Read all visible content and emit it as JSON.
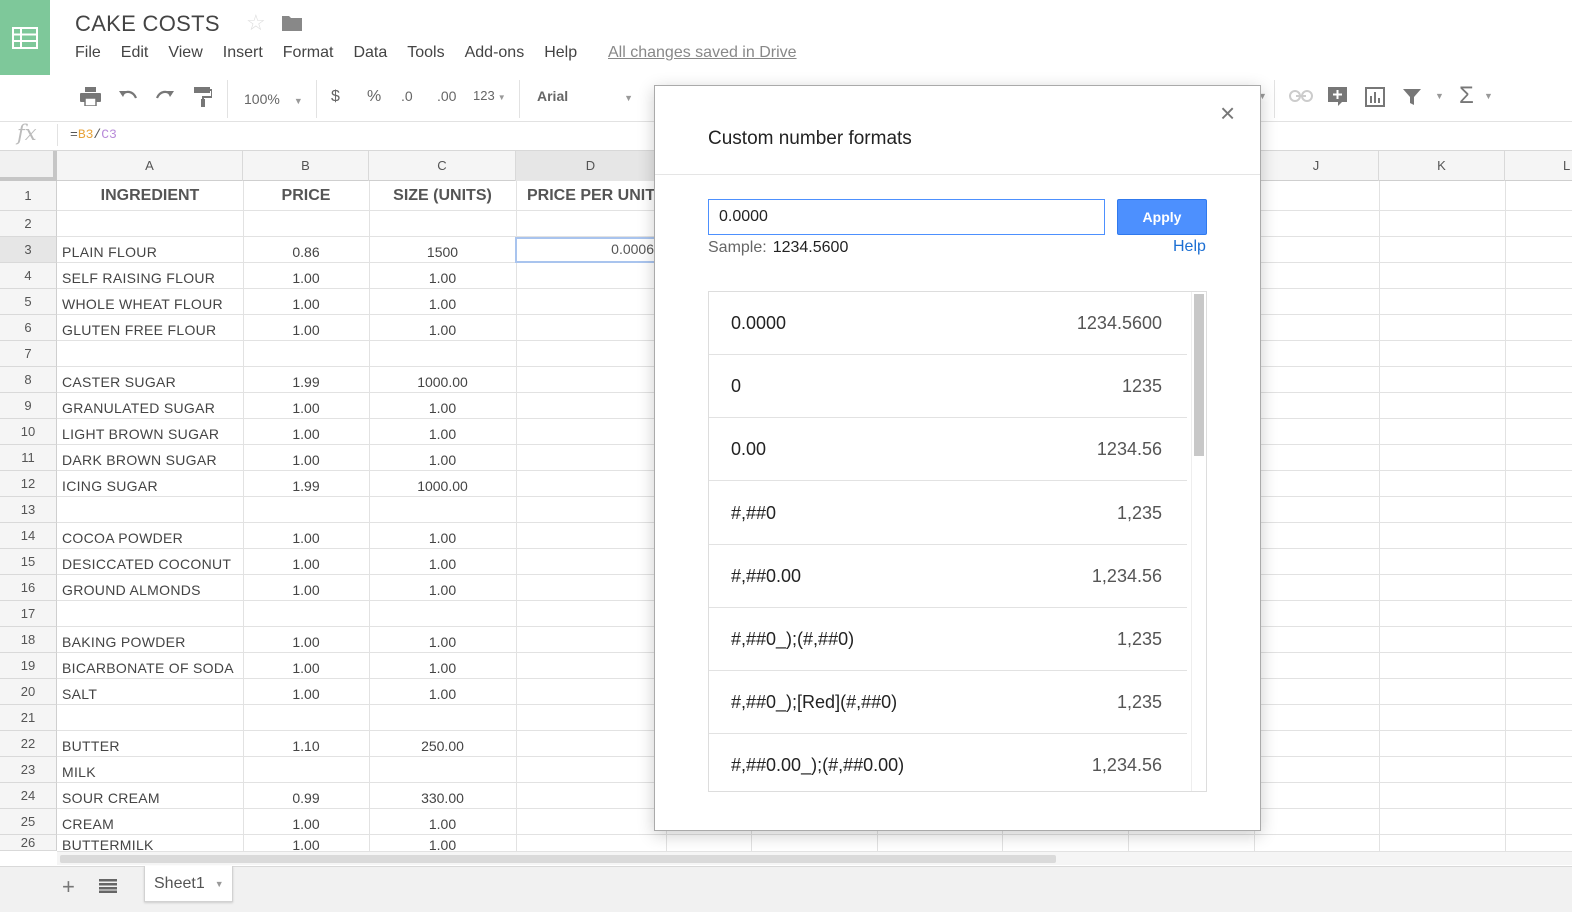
{
  "app": {
    "doc_title": "CAKE COSTS",
    "menu": [
      "File",
      "Edit",
      "View",
      "Insert",
      "Format",
      "Data",
      "Tools",
      "Add-ons",
      "Help"
    ],
    "saved_status": "All changes saved in Drive"
  },
  "toolbar": {
    "zoom": "100%",
    "currency": "$",
    "percent": "%",
    "dec_decrease": ".0",
    "dec_increase": ".00",
    "more_formats": "123",
    "font": "Arial",
    "icons": [
      "print-icon",
      "undo-icon",
      "redo-icon",
      "paint-format-icon",
      "link-icon",
      "insert-comment-icon",
      "insert-chart-icon",
      "filter-icon",
      "functions-icon"
    ]
  },
  "formula_bar": {
    "label": "fx",
    "prefix": "=",
    "ref1": "B3",
    "sep": "/",
    "ref2": "C3"
  },
  "grid": {
    "columns": [
      "A",
      "B",
      "C",
      "D",
      "J",
      "K",
      "L"
    ],
    "selected_cell_value": "0.0006",
    "header_row": [
      "INGREDIENT",
      "PRICE",
      "SIZE (UNITS)",
      "PRICE PER UNIT"
    ],
    "rows": [
      {
        "n": "1"
      },
      {
        "n": "2",
        "a": "",
        "b": "",
        "c": ""
      },
      {
        "n": "3",
        "a": "PLAIN FLOUR",
        "b": "0.86",
        "c": "1500"
      },
      {
        "n": "4",
        "a": "SELF RAISING FLOUR",
        "b": "1.00",
        "c": "1.00"
      },
      {
        "n": "5",
        "a": "WHOLE WHEAT FLOUR",
        "b": "1.00",
        "c": "1.00"
      },
      {
        "n": "6",
        "a": "GLUTEN FREE FLOUR",
        "b": "1.00",
        "c": "1.00"
      },
      {
        "n": "7",
        "a": "",
        "b": "",
        "c": ""
      },
      {
        "n": "8",
        "a": "CASTER SUGAR",
        "b": "1.99",
        "c": "1000.00"
      },
      {
        "n": "9",
        "a": "GRANULATED SUGAR",
        "b": "1.00",
        "c": "1.00"
      },
      {
        "n": "10",
        "a": "LIGHT BROWN SUGAR",
        "b": "1.00",
        "c": "1.00"
      },
      {
        "n": "11",
        "a": "DARK BROWN SUGAR",
        "b": "1.00",
        "c": "1.00"
      },
      {
        "n": "12",
        "a": "ICING SUGAR",
        "b": "1.99",
        "c": "1000.00"
      },
      {
        "n": "13",
        "a": "",
        "b": "",
        "c": ""
      },
      {
        "n": "14",
        "a": "COCOA POWDER",
        "b": "1.00",
        "c": "1.00"
      },
      {
        "n": "15",
        "a": "DESICCATED COCONUT",
        "b": "1.00",
        "c": "1.00"
      },
      {
        "n": "16",
        "a": "GROUND ALMONDS",
        "b": "1.00",
        "c": "1.00"
      },
      {
        "n": "17",
        "a": "",
        "b": "",
        "c": ""
      },
      {
        "n": "18",
        "a": "BAKING POWDER",
        "b": "1.00",
        "c": "1.00"
      },
      {
        "n": "19",
        "a": "BICARBONATE OF SODA",
        "b": "1.00",
        "c": "1.00"
      },
      {
        "n": "20",
        "a": "SALT",
        "b": "1.00",
        "c": "1.00"
      },
      {
        "n": "21",
        "a": "",
        "b": "",
        "c": ""
      },
      {
        "n": "22",
        "a": "BUTTER",
        "b": "1.10",
        "c": "250.00"
      },
      {
        "n": "23",
        "a": "MILK",
        "b": "",
        "c": ""
      },
      {
        "n": "24",
        "a": "SOUR CREAM",
        "b": "0.99",
        "c": "330.00"
      },
      {
        "n": "25",
        "a": "CREAM",
        "b": "1.00",
        "c": "1.00"
      },
      {
        "n": "26",
        "a": "BUTTERMILK",
        "b": "1.00",
        "c": "1.00"
      }
    ]
  },
  "sheets": {
    "add": "+",
    "tab": "Sheet1"
  },
  "dialog": {
    "title": "Custom number formats",
    "close": "×",
    "input_value": "0.0000",
    "apply": "Apply",
    "sample_label": "Sample:",
    "sample_value": "1234.5600",
    "help": "Help",
    "formats": [
      {
        "pattern": "0.0000",
        "example": "1234.5600"
      },
      {
        "pattern": "0",
        "example": "1235"
      },
      {
        "pattern": "0.00",
        "example": "1234.56"
      },
      {
        "pattern": "#,##0",
        "example": "1,235"
      },
      {
        "pattern": "#,##0.00",
        "example": "1,234.56"
      },
      {
        "pattern": "#,##0_);(#,##0)",
        "example": "1,235"
      },
      {
        "pattern": "#,##0_);[Red](#,##0)",
        "example": "1,235"
      },
      {
        "pattern": "#,##0.00_);(#,##0.00)",
        "example": "1,234.56"
      }
    ]
  }
}
